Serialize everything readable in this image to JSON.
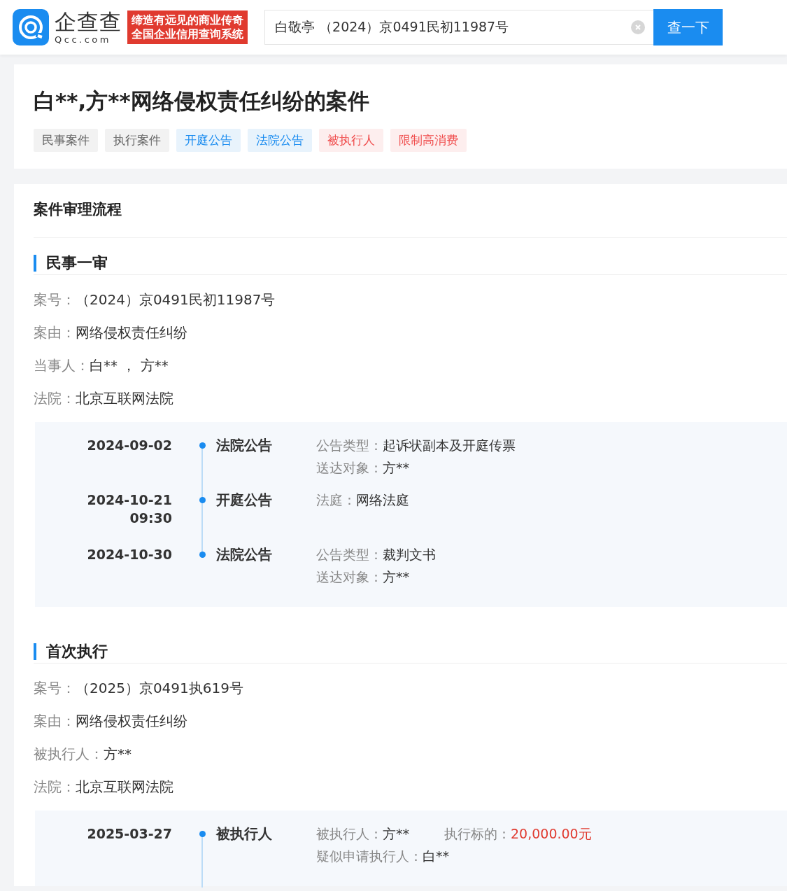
{
  "header": {
    "logo": {
      "name": "企查查",
      "domain": "Qcc.com"
    },
    "slogan": [
      "缔造有远见的商业传奇",
      "全国企业信用查询系统"
    ],
    "search": {
      "value": "白敬亭 （2024）京0491民初11987号"
    },
    "search_button": "查一下"
  },
  "case": {
    "title": "白**,方**网络侵权责任纠纷的案件",
    "tags": [
      {
        "label": "民事案件",
        "kind": "neutral"
      },
      {
        "label": "执行案件",
        "kind": "neutral"
      },
      {
        "label": "开庭公告",
        "kind": "info"
      },
      {
        "label": "法院公告",
        "kind": "info"
      },
      {
        "label": "被执行人",
        "kind": "risk"
      },
      {
        "label": "限制高消费",
        "kind": "risk"
      }
    ]
  },
  "process": {
    "heading": "案件审理流程",
    "stages": [
      {
        "title": "民事一审",
        "fields": [
          {
            "label": "案号：",
            "value": "（2024）京0491民初11987号"
          },
          {
            "label": "案由：",
            "value": "网络侵权责任纠纷"
          },
          {
            "label": "当事人：",
            "value": "白** ， 方**"
          },
          {
            "label": "法院：",
            "value": "北京互联网法院"
          }
        ],
        "events": [
          {
            "date": "2024-09-02",
            "type": "法院公告",
            "lines": [
              [
                {
                  "label": "公告类型：",
                  "value": "起诉状副本及开庭传票",
                  "highlight": false
                }
              ],
              [
                {
                  "label": "送达对象：",
                  "value": "方**",
                  "highlight": false
                }
              ]
            ]
          },
          {
            "date": "2024-10-21",
            "time": "09:30",
            "type": "开庭公告",
            "lines": [
              [
                {
                  "label": "法庭：",
                  "value": "网络法庭",
                  "highlight": false
                }
              ]
            ]
          },
          {
            "date": "2024-10-30",
            "type": "法院公告",
            "lines": [
              [
                {
                  "label": "公告类型：",
                  "value": "裁判文书",
                  "highlight": false
                }
              ],
              [
                {
                  "label": "送达对象：",
                  "value": "方**",
                  "highlight": false
                }
              ]
            ]
          }
        ]
      },
      {
        "title": "首次执行",
        "fields": [
          {
            "label": "案号：",
            "value": "（2025）京0491执619号"
          },
          {
            "label": "案由：",
            "value": "网络侵权责任纠纷"
          },
          {
            "label": "被执行人：",
            "value": "方**"
          },
          {
            "label": "法院：",
            "value": "北京互联网法院"
          }
        ],
        "events": [
          {
            "date": "2025-03-27",
            "type": "被执行人",
            "lines": [
              [
                {
                  "label": "被执行人：",
                  "value": "方**",
                  "highlight": false
                },
                {
                  "label": "执行标的：",
                  "value": "20,000.00元",
                  "highlight": true
                }
              ],
              [
                {
                  "label": "疑似申请执行人：",
                  "value": "白**",
                  "highlight": false
                }
              ]
            ]
          }
        ]
      }
    ]
  }
}
